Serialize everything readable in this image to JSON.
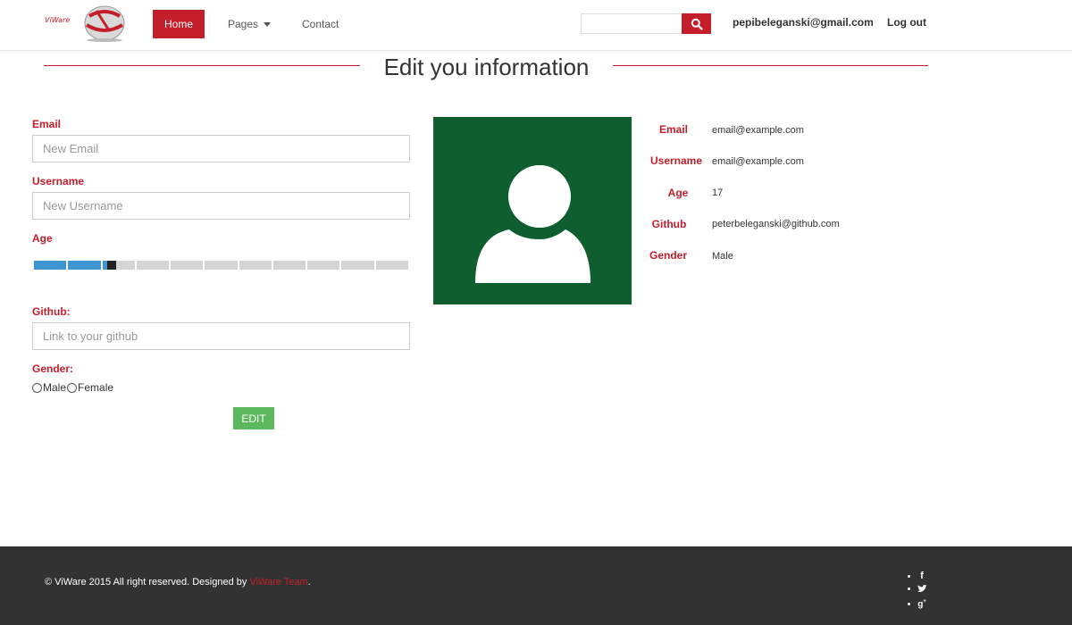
{
  "brand": {
    "logo_text": "ViWare",
    "accent_color": "#c41e2a"
  },
  "nav": {
    "home": "Home",
    "pages": "Pages",
    "contact": "Contact",
    "search_placeholder": "",
    "user_email": "pepibeleganski@gmail.com",
    "logout": "Log out"
  },
  "page": {
    "title": "Edit you information"
  },
  "form": {
    "email_label": "Email",
    "email_placeholder": "New Email",
    "username_label": "Username",
    "username_placeholder": "New Username",
    "age_label": "Age",
    "age_slider_level": 0.2,
    "github_label": "Github:",
    "github_placeholder": "Link to your github",
    "gender_label": "Gender:",
    "gender_options": [
      "Male",
      "Female"
    ],
    "edit_button": "EDIT"
  },
  "profile": {
    "avatar_color": "#0f5e2f",
    "email_label": "Email",
    "email_value": "email@example.com",
    "username_label": "Username",
    "username_value": "email@example.com",
    "age_label": "Age",
    "age_value": "17",
    "github_label": "Github",
    "github_value": "peterbeleganski@github.com",
    "gender_label": "Gender",
    "gender_value": "Male"
  },
  "footer": {
    "copyright": "© ViWare 2015 All right reserved. Designed by ",
    "team": "ViWare Team",
    "period": ".",
    "social": [
      "facebook-icon",
      "twitter-icon",
      "google-plus-icon"
    ]
  }
}
